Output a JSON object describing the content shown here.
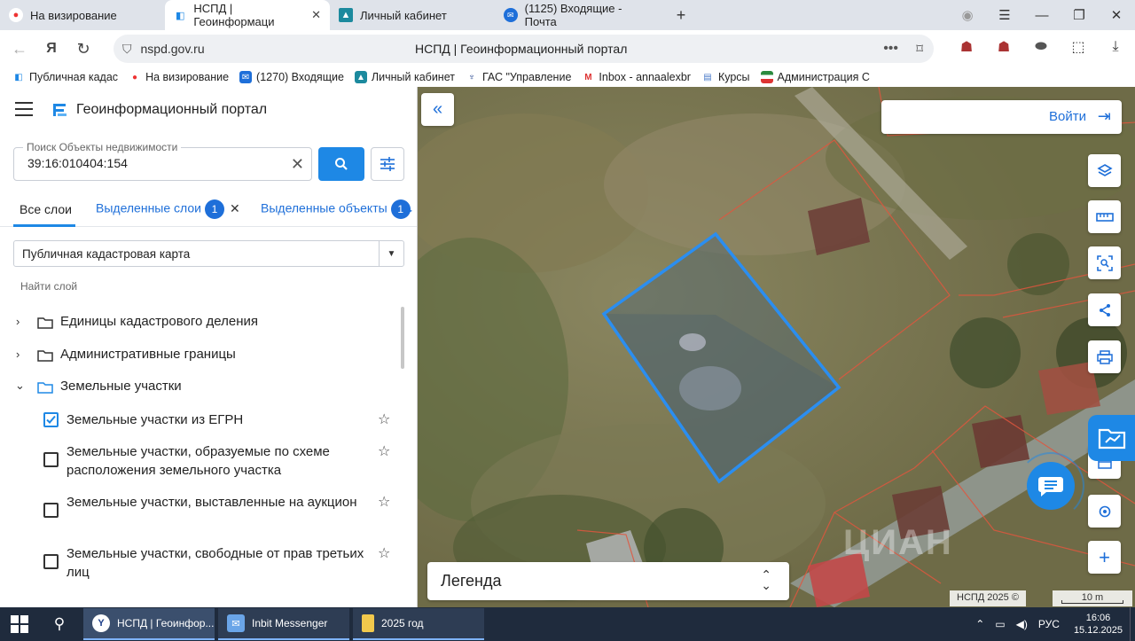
{
  "browser": {
    "tabs": [
      {
        "label": "На визирование",
        "icon": "yandex-icon"
      },
      {
        "label": "НСПД | Геоинформаци",
        "icon": "nspd-icon",
        "active": true
      },
      {
        "label": "Личный кабинет",
        "icon": "cabinet-icon"
      },
      {
        "label": "(1125) Входящие - Почта",
        "icon": "mail-icon"
      }
    ],
    "url": "nspd.gov.ru",
    "page_title": "НСПД | Геоинформационный портал",
    "bookmarks": [
      "Публичная кадас",
      "На визирование",
      "(1270) Входящие",
      "Личный кабинет",
      "ГАС \"Управление",
      "Inbox - annaalexbr",
      "Курсы",
      "Администрация С"
    ]
  },
  "portal": {
    "title": "Геоинформационный портал",
    "search": {
      "label": "Поиск Объекты недвижимости",
      "value": "39:16:010404:154"
    },
    "tabs": [
      {
        "label": "Все слои"
      },
      {
        "label": "Выделенные слои",
        "badge": "1"
      },
      {
        "label": "Выделенные объекты",
        "badge": "1"
      }
    ],
    "basemap": "Публичная кадастровая карта",
    "find_layer_placeholder": "Найти слой",
    "layer_groups": [
      {
        "label": "Единицы кадастрового деления",
        "expanded": false
      },
      {
        "label": "Административные границы",
        "expanded": false
      },
      {
        "label": "Земельные участки",
        "expanded": true
      }
    ],
    "layers": [
      {
        "label": "Земельные участки из ЕГРН",
        "checked": true
      },
      {
        "label": "Земельные участки, образуемые по схеме расположения земельного участка",
        "checked": false
      },
      {
        "label": "Земельные участки, выставленные на аукцион",
        "checked": false
      },
      {
        "label": "Земельные участки, свободные от прав третьих лиц",
        "checked": false
      }
    ]
  },
  "map": {
    "login_label": "Войти",
    "legend_label": "Легенда",
    "copyright": "НСПД 2025 ©",
    "scale_label": "10 m",
    "watermark": "ЦИАН"
  },
  "taskbar": {
    "apps": [
      {
        "label": "НСПД | Геоинфор..."
      },
      {
        "label": "Inbit Messenger"
      },
      {
        "label": "2025 год"
      }
    ],
    "language": "РУС",
    "time": "16:06",
    "date": "15.12.2025"
  },
  "colors": {
    "accent": "#1e88e5",
    "parcel_outline": "#2b8ef0",
    "cadastral_lines": "#e0563e"
  }
}
